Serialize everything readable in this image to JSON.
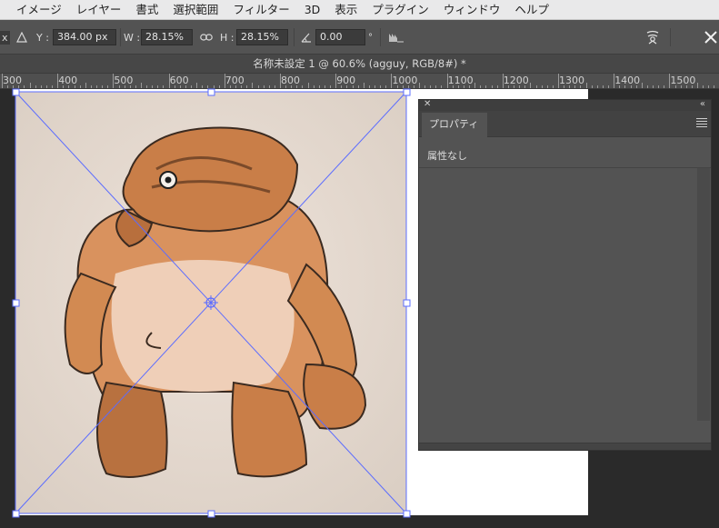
{
  "menu": [
    "イメージ",
    "レイヤー",
    "書式",
    "選択範囲",
    "フィルター",
    "3D",
    "表示",
    "プラグイン",
    "ウィンドウ",
    "ヘルプ"
  ],
  "options": {
    "partial_label": "x",
    "y_label": "Y :",
    "y_value": "384.00 px",
    "w_label": "W :",
    "w_value": "28.15%",
    "h_label": "H :",
    "h_value": "28.15%",
    "angle_value": "0.00",
    "degree": "°"
  },
  "document": {
    "title": "名称未設定 1 @ 60.6% (agguy, RGB/8#) *"
  },
  "ruler": {
    "labels": [
      "300",
      "400",
      "500",
      "600",
      "700",
      "800",
      "900",
      "1000",
      "1100",
      "1200",
      "1300",
      "1400",
      "1500"
    ]
  },
  "properties_panel": {
    "tab": "プロパティ",
    "status": "属性なし"
  },
  "colors": {
    "accent_transform": "#5b6cff",
    "panel_bg": "#535353",
    "menubar_bg": "#e9e9ea"
  }
}
